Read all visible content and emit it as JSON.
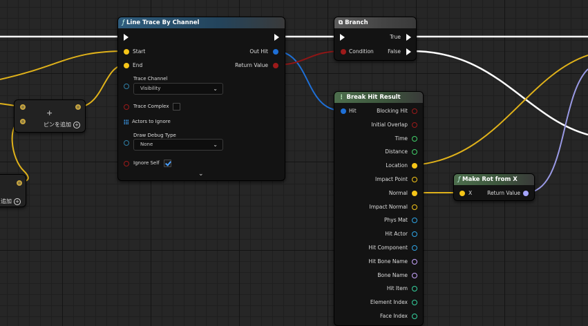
{
  "colors": {
    "exec": "#ffffff",
    "vector": "#f5c518",
    "struct": "#1e6fd6",
    "bool": "#9d1a1a",
    "float": "#41d16a",
    "object": "#2fa5e6",
    "name": "#c9a6ff",
    "int": "#35d4a0",
    "rotator": "#a6a6ff"
  },
  "line_trace": {
    "title": "Line Trace By Channel",
    "pins": {
      "start": "Start",
      "end": "End",
      "out_hit": "Out Hit",
      "return_value": "Return Value",
      "trace_channel": "Trace Channel",
      "trace_channel_value": "Visibility",
      "trace_complex": "Trace Complex",
      "actors_to_ignore": "Actors to Ignore",
      "draw_debug_type": "Draw Debug Type",
      "draw_debug_value": "None",
      "ignore_self": "Ignore Self"
    },
    "trace_complex_checked": false,
    "ignore_self_checked": true,
    "expand_icon": "chevron-down-icon"
  },
  "branch": {
    "title": "Branch",
    "pins": {
      "condition": "Condition",
      "true": "True",
      "false": "False"
    }
  },
  "break_hit": {
    "title": "Break Hit Result",
    "input": "Hit",
    "outputs": [
      "Blocking Hit",
      "Initial Overlap",
      "Time",
      "Distance",
      "Location",
      "Impact Point",
      "Normal",
      "Impact Normal",
      "Phys Mat",
      "Hit Actor",
      "Hit Component",
      "Hit Bone Name",
      "Bone Name",
      "Hit Item",
      "Element Index",
      "Face Index"
    ]
  },
  "make_rot": {
    "title": "Make Rot from X",
    "pins": {
      "x": "X",
      "return_value": "Return Value"
    }
  },
  "add_pin_node": {
    "label": "ピンを追加",
    "plus": "+"
  },
  "add_pin_node2": {
    "label": "追加"
  }
}
